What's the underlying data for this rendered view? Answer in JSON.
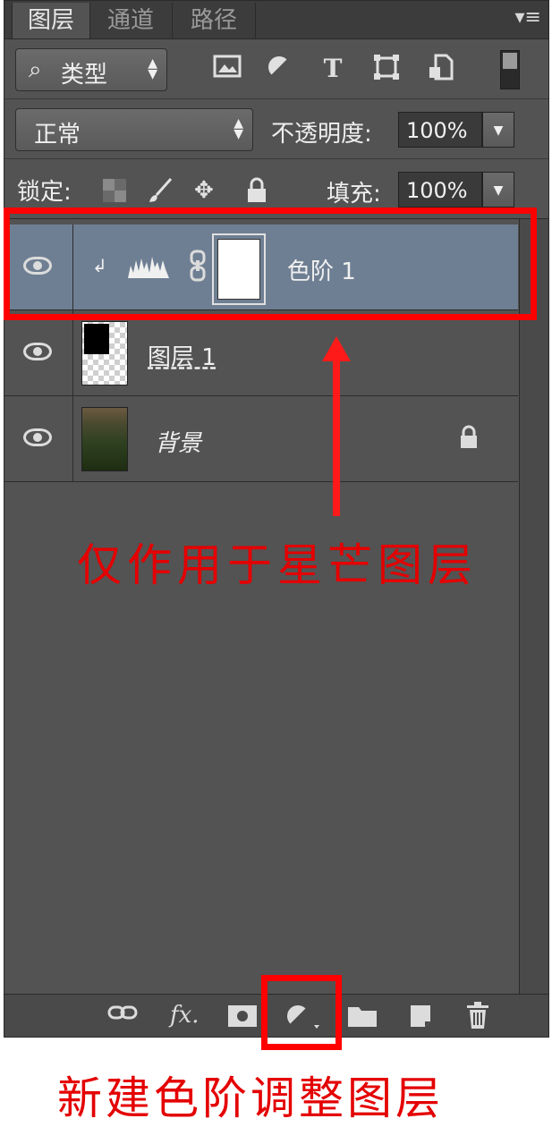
{
  "tabs": [
    {
      "label": "图层",
      "active": true
    },
    {
      "label": "通道",
      "active": false
    },
    {
      "label": "路径",
      "active": false
    }
  ],
  "filter": {
    "kind_label": "类型",
    "icons": [
      "image-filter-icon",
      "adjustment-filter-icon",
      "type-filter-icon",
      "shape-filter-icon",
      "smart-object-filter-icon"
    ]
  },
  "blend": {
    "mode": "正常",
    "opacity_label": "不透明度:",
    "opacity_value": "100%"
  },
  "lock": {
    "label": "锁定:",
    "fill_label": "填充:",
    "fill_value": "100%"
  },
  "layers": [
    {
      "name": "色阶 1",
      "selected": true,
      "type": "levels-adjustment"
    },
    {
      "name": "图层 1",
      "selected": false,
      "type": "pixel"
    },
    {
      "name": "背景",
      "selected": false,
      "type": "background",
      "locked": true
    }
  ],
  "annotations": {
    "arrow_caption": "仅作用于星芒图层",
    "bottom_caption": "新建色阶调整图层",
    "color": "#e40000"
  },
  "colors": {
    "panel_bg": "#535353",
    "selected_row": "#6f7f93",
    "highlight": "#ff0000"
  }
}
